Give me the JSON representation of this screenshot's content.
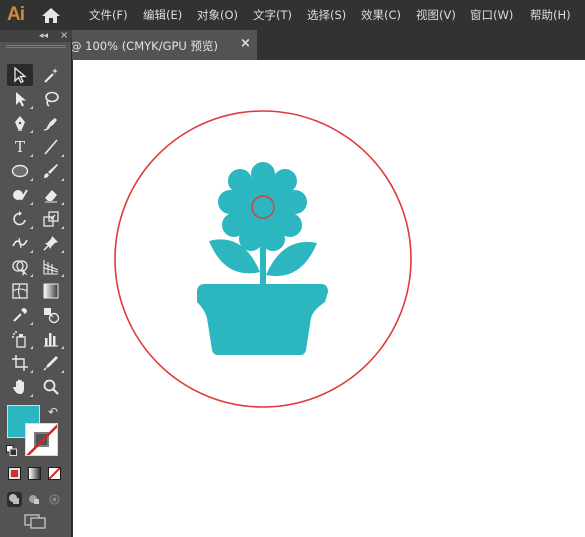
{
  "app": {
    "logo": "Ai",
    "home_icon": "home-icon"
  },
  "menu": [
    {
      "label": "文件(F)"
    },
    {
      "label": "编辑(E)"
    },
    {
      "label": "对象(O)"
    },
    {
      "label": "文字(T)"
    },
    {
      "label": "选择(S)"
    },
    {
      "label": "效果(C)"
    },
    {
      "label": "视图(V)"
    },
    {
      "label": "窗口(W)"
    },
    {
      "label": "帮助(H)"
    }
  ],
  "document_tab": {
    "label": "@ 100% (CMYK/GPU 预览)",
    "close": "×"
  },
  "toolbox": {
    "collapse": "◂◂",
    "close": "×",
    "type_tool_glyph": "T",
    "swap_glyph": "↶"
  },
  "colors": {
    "fill": "#2bb6c0",
    "stroke": "none",
    "artwork_fill": "#2bb6c0",
    "circle_stroke": "#e03a3a",
    "app_accent": "#d08a3a"
  }
}
